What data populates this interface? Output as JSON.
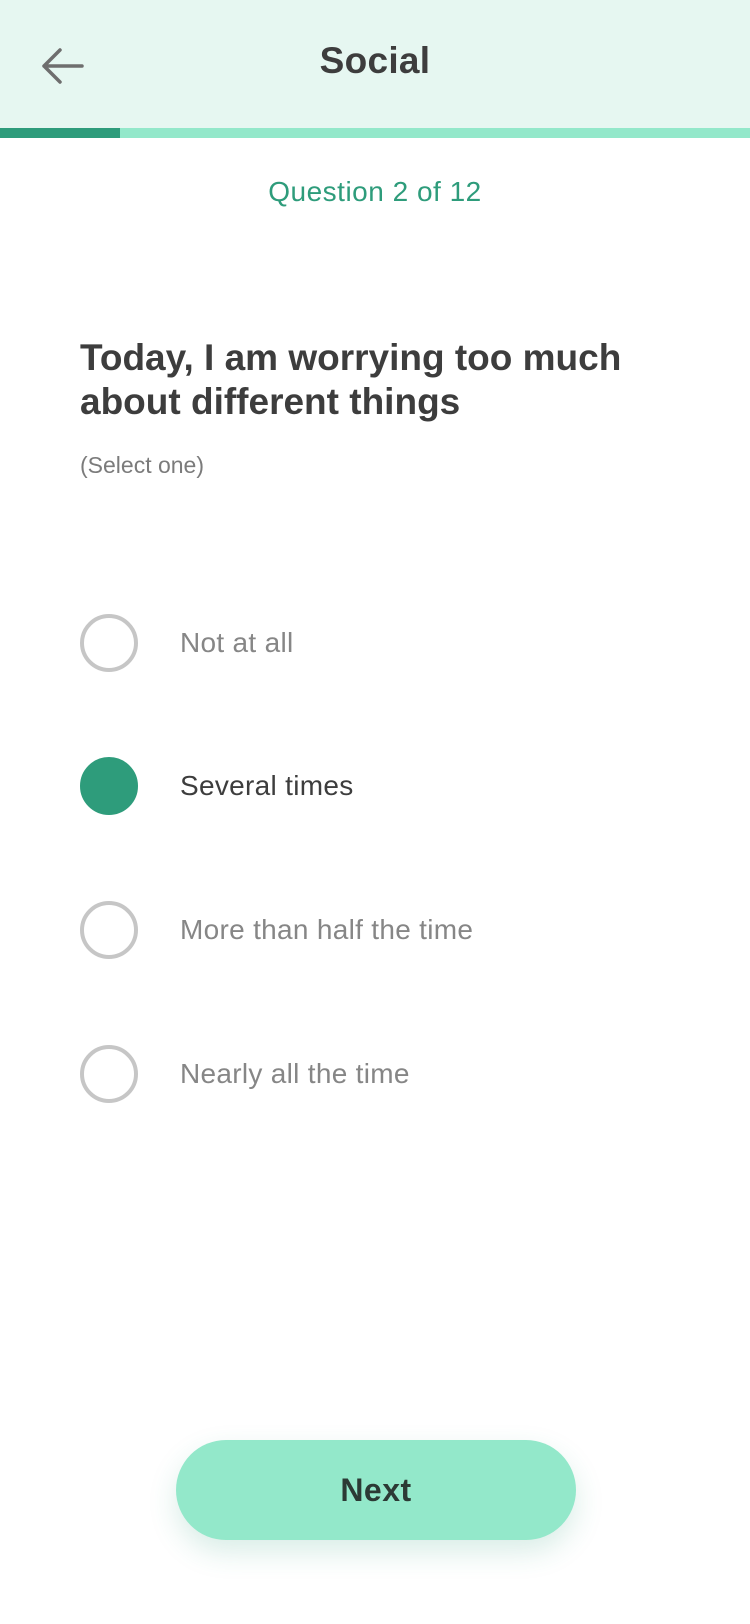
{
  "header": {
    "title": "Social",
    "back_icon": "arrow-left-icon"
  },
  "progress": {
    "current": 2,
    "total": 12,
    "fraction": 0.16
  },
  "question": {
    "counter": "Question 2 of 12",
    "text": "Today, I am worrying too much about different things",
    "hint": "(Select one)"
  },
  "options": [
    {
      "label": "Not at all",
      "selected": false
    },
    {
      "label": "Several times",
      "selected": true
    },
    {
      "label": "More than half the time",
      "selected": false
    },
    {
      "label": "Nearly all the time",
      "selected": false
    }
  ],
  "footer": {
    "next_label": "Next"
  },
  "colors": {
    "accent": "#2e9c7b",
    "accent_light": "#93e8ca",
    "header_bg": "#e6f7f1"
  }
}
